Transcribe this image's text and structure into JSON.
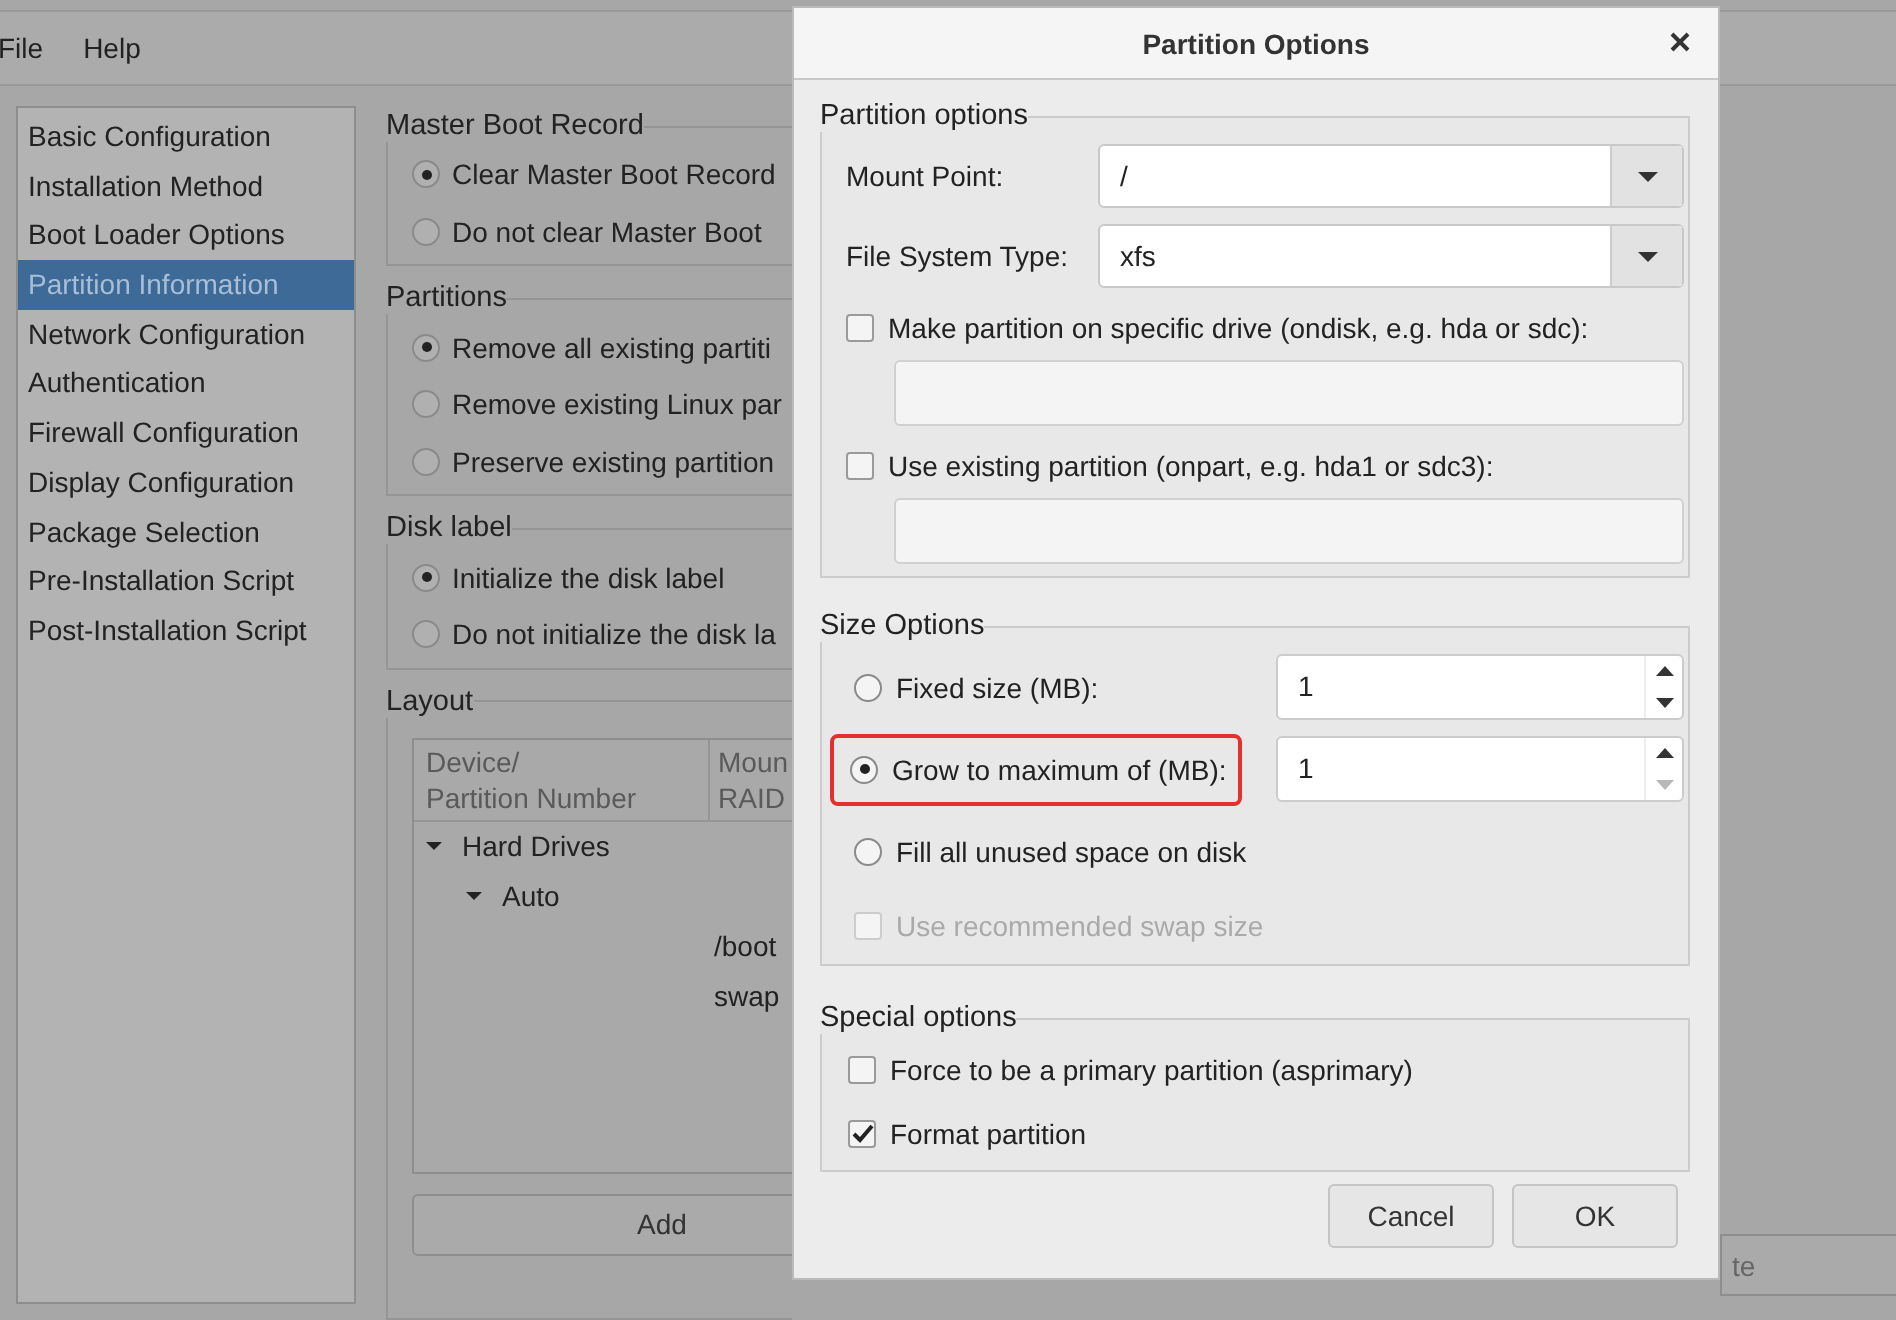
{
  "menu": [
    "File",
    "Help"
  ],
  "sidebar": {
    "items": [
      {
        "label": "Basic Configuration",
        "selected": false
      },
      {
        "label": "Installation Method",
        "selected": false
      },
      {
        "label": "Boot Loader Options",
        "selected": false
      },
      {
        "label": "Partition Information",
        "selected": true
      },
      {
        "label": "Network Configuration",
        "selected": false
      },
      {
        "label": "Authentication",
        "selected": false
      },
      {
        "label": "Firewall Configuration",
        "selected": false
      },
      {
        "label": "Display Configuration",
        "selected": false
      },
      {
        "label": "Package Selection",
        "selected": false
      },
      {
        "label": "Pre-Installation Script",
        "selected": false
      },
      {
        "label": "Post-Installation Script",
        "selected": false
      }
    ]
  },
  "groups": [
    {
      "title": "Master Boot Record",
      "options": [
        {
          "label": "Clear Master Boot Record",
          "selected": true
        },
        {
          "label": "Do not clear Master Boot",
          "selected": false
        }
      ]
    },
    {
      "title": "Partitions",
      "options": [
        {
          "label": "Remove all existing partiti",
          "selected": true
        },
        {
          "label": "Remove existing Linux par",
          "selected": false
        },
        {
          "label": "Preserve existing partition",
          "selected": false
        }
      ]
    },
    {
      "title": "Disk label",
      "options": [
        {
          "label": "Initialize the disk label",
          "selected": true
        },
        {
          "label": "Do not initialize the disk la",
          "selected": false
        }
      ]
    }
  ],
  "layout": {
    "title": "Layout",
    "columns": [
      [
        "Device/",
        "Partition Number"
      ],
      [
        "Moun",
        "RAID"
      ]
    ],
    "tree": [
      {
        "label": "Hard Drives",
        "expanded": true,
        "children": [
          {
            "label": "Auto",
            "expanded": true,
            "children": [
              {
                "column_2": "/boot"
              },
              {
                "column_2": "swap"
              }
            ]
          }
        ]
      }
    ],
    "buttons": [
      "Add",
      "te"
    ]
  },
  "dialog": {
    "title": "Partition Options",
    "partition_options": {
      "title": "Partition options",
      "fields": [
        {
          "label": "Mount Point:",
          "value": "/"
        },
        {
          "label": "File System Type:",
          "value": "xfs"
        }
      ],
      "checks": [
        {
          "label": "Make partition on specific drive (ondisk, e.g. hda or sdc):",
          "checked": false
        },
        {
          "label": "Use existing partition (onpart, e.g. hda1 or sdc3):",
          "checked": false
        }
      ]
    },
    "size_options": {
      "title": "Size Options",
      "rows": [
        {
          "kind": "radio",
          "label": "Fixed size (MB):",
          "selected": false,
          "value": "1",
          "decrement_disabled": false,
          "highlighted": false
        },
        {
          "kind": "radio",
          "label": "Grow to maximum of (MB):",
          "selected": true,
          "value": "1",
          "decrement_disabled": true,
          "highlighted": true
        },
        {
          "kind": "radio",
          "label": "Fill all unused space on disk",
          "selected": false,
          "highlighted": false
        },
        {
          "kind": "checkbox",
          "label": "Use recommended swap size",
          "checked": false,
          "disabled": true,
          "highlighted": false
        }
      ]
    },
    "special_options": {
      "title": "Special options",
      "checks": [
        {
          "label": "Force to be a primary partition (asprimary)",
          "checked": false
        },
        {
          "label": "Format partition",
          "checked": true
        }
      ]
    },
    "buttons": [
      "Cancel",
      "OK"
    ]
  }
}
